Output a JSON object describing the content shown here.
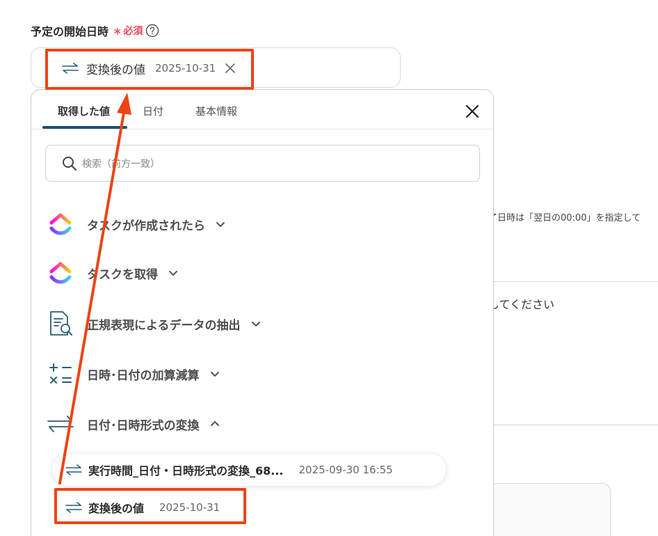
{
  "field": {
    "label": "予定の開始日時",
    "required_star": "∗",
    "required_text": "必須",
    "selected_value": {
      "label": "変換後の値",
      "date": "2025-10-31"
    }
  },
  "background": {
    "hint_text": "了日時は「翌日の00:00」を指定して",
    "instruction_text": "してください"
  },
  "dropdown": {
    "tabs": [
      {
        "label": "取得した値",
        "active": true
      },
      {
        "label": "日付",
        "active": false
      },
      {
        "label": "基本情報",
        "active": false
      }
    ],
    "search_placeholder": "検索（前方一致）",
    "groups": [
      {
        "label": "タスクが作成されたら",
        "icon": "clickup-logo-icon",
        "expanded": false
      },
      {
        "label": "タスクを取得",
        "icon": "clickup-logo-icon",
        "expanded": false
      },
      {
        "label": "正規表現によるデータの抽出",
        "icon": "document-search-icon",
        "expanded": false
      },
      {
        "label": "日時･日付の加算減算",
        "icon": "calculator-icon",
        "expanded": false
      },
      {
        "label": "日付･日時形式の変換",
        "icon": "convert-arrows-icon",
        "expanded": true
      }
    ],
    "items": [
      {
        "label": "実行時間_日付・日時形式の変換_68...",
        "date": "2025-09-30 16:55"
      },
      {
        "label": "変換後の値",
        "date": "2025-10-31"
      }
    ]
  },
  "colors": {
    "highlight": "#ee4415",
    "required": "#e8455a",
    "tab_underline": "#1f4e6e",
    "icon_teal": "#2a5d73"
  }
}
